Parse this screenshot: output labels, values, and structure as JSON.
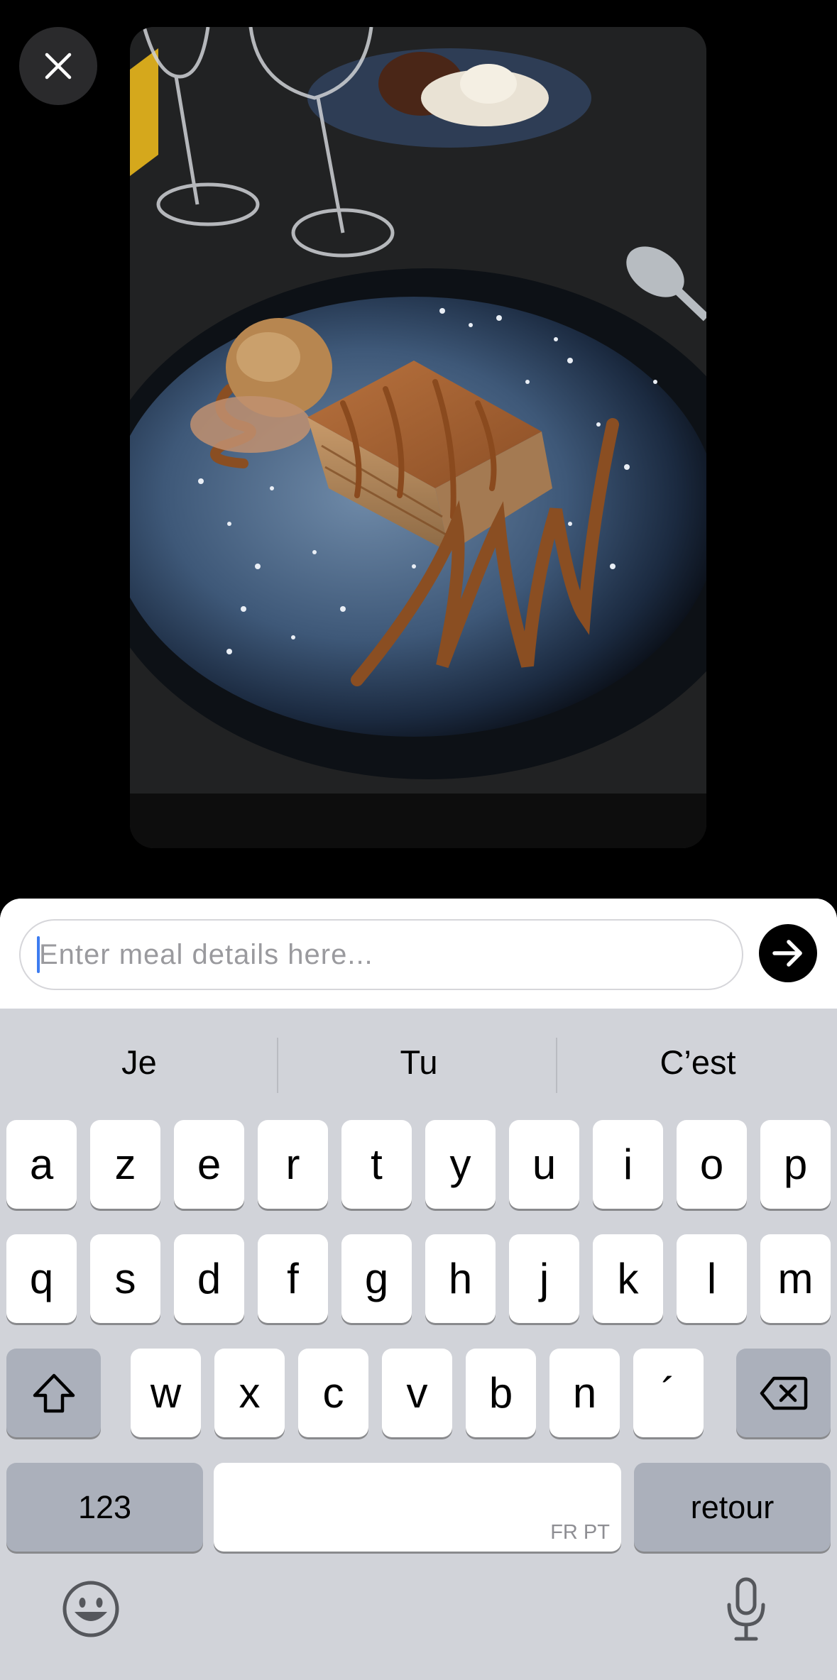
{
  "photo": {
    "subject": "dessert plate photo"
  },
  "close_button": {
    "icon": "close-icon"
  },
  "input": {
    "placeholder": "Enter meal details here...",
    "value": ""
  },
  "send_button": {
    "icon": "arrow-right-icon"
  },
  "suggestions": [
    "Je",
    "Tu",
    "C’est"
  ],
  "keyboard": {
    "row1": [
      "a",
      "z",
      "e",
      "r",
      "t",
      "y",
      "u",
      "i",
      "o",
      "p"
    ],
    "row2": [
      "q",
      "s",
      "d",
      "f",
      "g",
      "h",
      "j",
      "k",
      "l",
      "m"
    ],
    "row3": [
      "w",
      "x",
      "c",
      "v",
      "b",
      "n",
      "´"
    ],
    "numbers_label": "123",
    "space_lang": "FR PT",
    "return_label": "retour",
    "shift_icon": "shift-icon",
    "delete_icon": "delete-icon",
    "emoji_icon": "emoji-icon",
    "mic_icon": "microphone-icon"
  },
  "colors": {
    "keyboard_bg": "#d1d3d9",
    "key_bg": "#ffffff",
    "dark_key_bg": "#abb0bb",
    "caret": "#3d7cf0"
  }
}
